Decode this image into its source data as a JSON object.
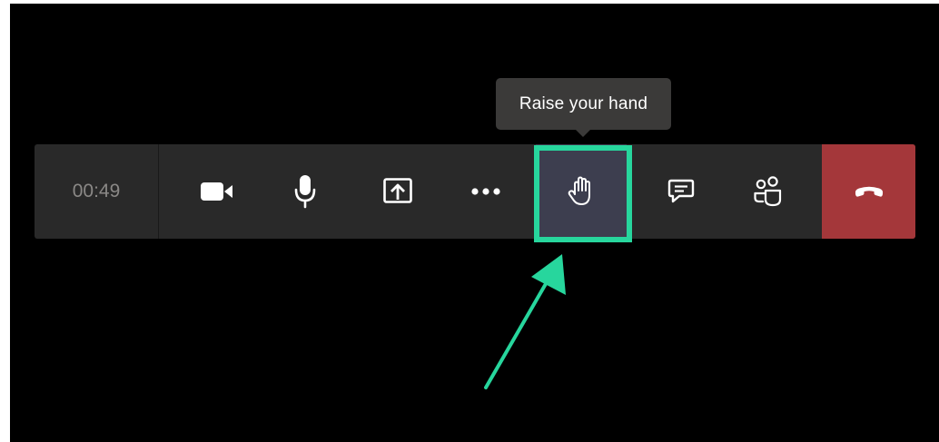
{
  "tooltip": {
    "text": "Raise your hand"
  },
  "toolbar": {
    "timer": "00:49",
    "buttons": [
      {
        "name": "camera",
        "icon": "video-camera-icon"
      },
      {
        "name": "microphone",
        "icon": "microphone-icon"
      },
      {
        "name": "share",
        "icon": "share-screen-icon"
      },
      {
        "name": "more",
        "icon": "more-options-icon"
      },
      {
        "name": "raise-hand",
        "icon": "hand-icon"
      },
      {
        "name": "chat",
        "icon": "chat-icon"
      },
      {
        "name": "participants",
        "icon": "people-icon"
      },
      {
        "name": "hang-up",
        "icon": "phone-hangup-icon"
      }
    ]
  },
  "colors": {
    "toolbar_bg": "#292929",
    "active_button_bg": "#3d3e4f",
    "hangup_bg": "#a4373a",
    "highlight": "#27d69d",
    "tooltip_bg": "#3b3a39"
  }
}
